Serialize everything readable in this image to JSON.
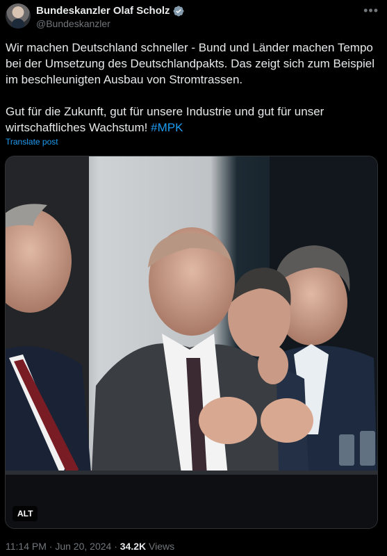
{
  "author": {
    "display_name": "Bundeskanzler Olaf Scholz",
    "handle": "@Bundeskanzler",
    "verified_icon": "verified-badge-icon"
  },
  "more_icon": "more-options-icon",
  "tweet": {
    "paragraph1": "Wir machen Deutschland schneller - Bund und Länder machen Tempo bei der Umsetzung des Deutschlandpakts. Das zeigt sich zum Beispiel im beschleunigten Ausbau von Stromtrassen.",
    "paragraph2": "Gut für die Zukunft, gut für unsere Industrie und gut für unser wirtschaftliches Wachstum!",
    "hashtag": "#MPK"
  },
  "translate_label": "Translate post",
  "media": {
    "alt_label": "ALT"
  },
  "meta": {
    "time": "11:14 PM",
    "separator1": "·",
    "date": "Jun 20, 2024",
    "separator2": "·",
    "views_count": "34.2K",
    "views_label": "Views"
  },
  "colors": {
    "background": "#000000",
    "text": "#e7e9ea",
    "secondary": "#71767b",
    "accent": "#1d9bf0"
  }
}
